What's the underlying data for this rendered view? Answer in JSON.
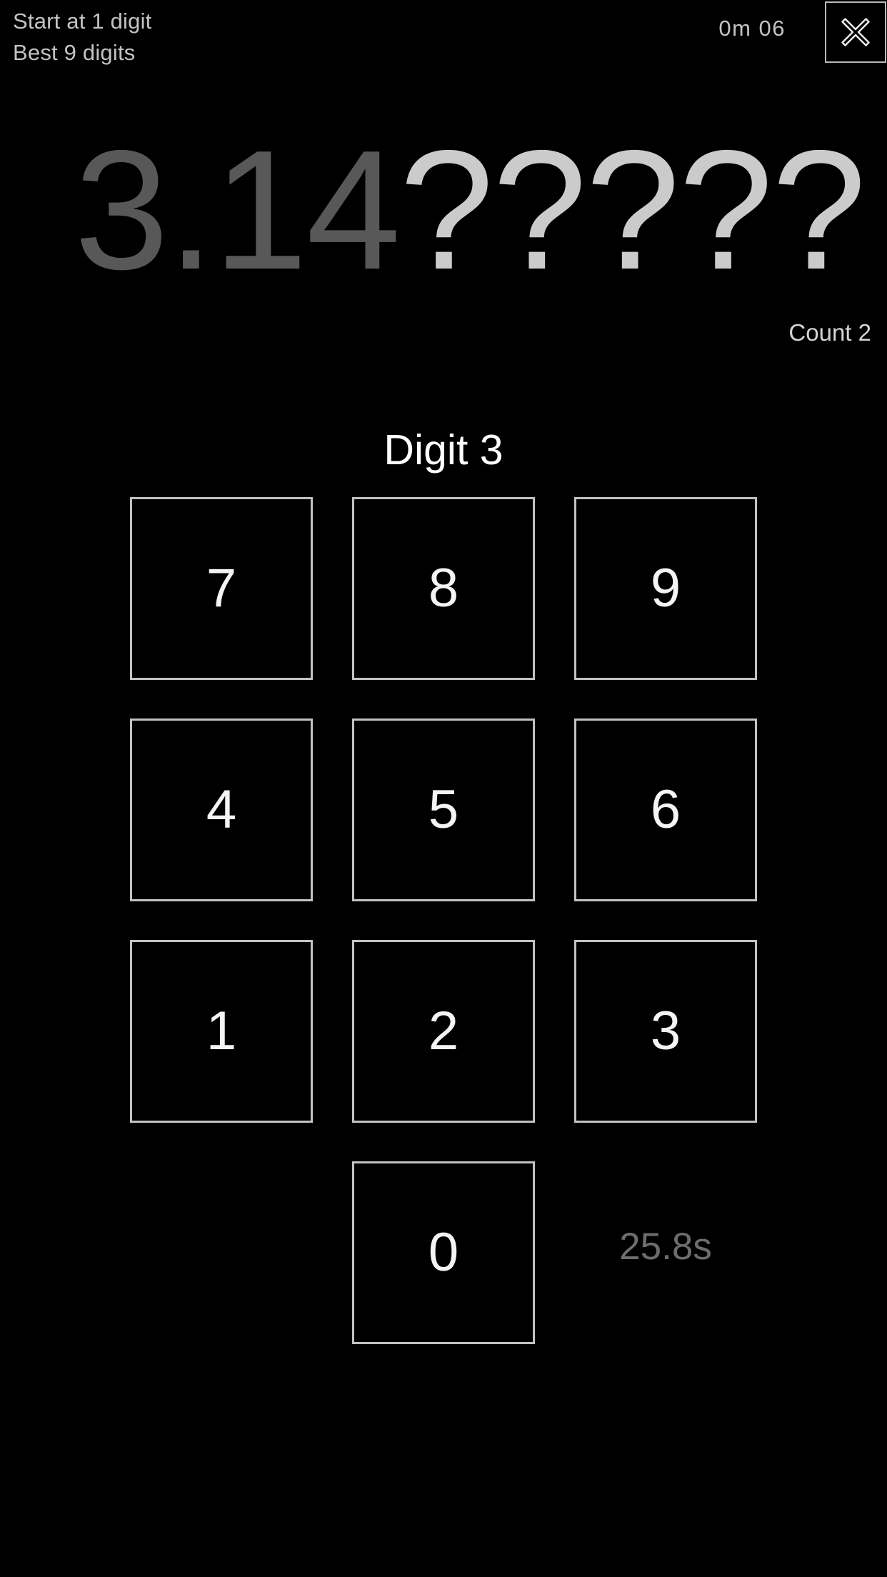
{
  "hud": {
    "start_label": "Start at 1 digit",
    "best_label": "Best 9 digits",
    "session_timer": "0m 06",
    "close_icon": "close-x-icon"
  },
  "pi_display": {
    "known_digits": "3.14",
    "unknown_digits": "?????",
    "count_label": "Count 2"
  },
  "prompt": {
    "digit_label": "Digit 3"
  },
  "keypad": {
    "rows": [
      {
        "keys": [
          "7",
          "8",
          "9"
        ]
      },
      {
        "keys": [
          "4",
          "5",
          "6"
        ]
      },
      {
        "keys": [
          "1",
          "2",
          "3"
        ]
      },
      {
        "keys": [
          "0"
        ]
      }
    ]
  },
  "elapsed": {
    "value": "25.8s"
  },
  "colors": {
    "background": "#000000",
    "hud_text": "#c3c3c3",
    "pi_known": "#585858",
    "pi_unknown": "#cbcbcb",
    "prompt_text": "#ffffff",
    "key_border": "#c2c2c2",
    "key_text": "#f4f4f4",
    "elapsed_text": "#6d6d6d"
  }
}
